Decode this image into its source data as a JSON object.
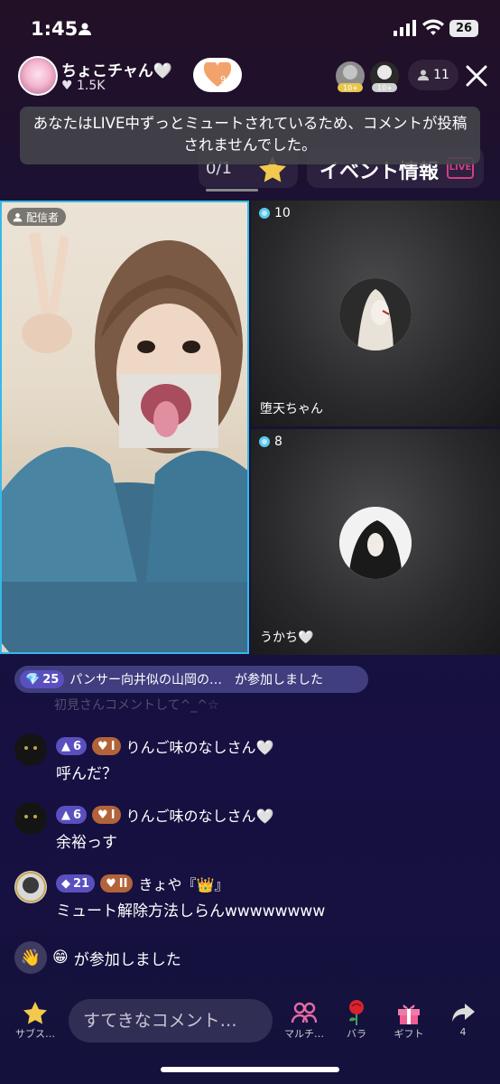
{
  "status_bar": {
    "time": "1:45",
    "battery": "26"
  },
  "host": {
    "name": "ちょこチャん🤍",
    "likes": "1.5K",
    "heart_count": "9"
  },
  "viewers": {
    "badges": [
      "10+",
      "10+"
    ],
    "count": "11"
  },
  "toast": {
    "message": "あなたはLIVE中ずっとミュートされているため、コメントが投稿されませんでした。"
  },
  "event_bar": {
    "progress": "0/1",
    "event_label": "イベント情報",
    "live_badge": "LIVE"
  },
  "grid": {
    "host_badge": "配信者",
    "guests": [
      {
        "points": "10",
        "name": "堕天ちゃん"
      },
      {
        "points": "8",
        "name": "うかち🤍"
      }
    ]
  },
  "join_banner": {
    "level": "25",
    "text": "パンサー向井似の山岡の…　が参加しました"
  },
  "faded_comment": "初見さんコメントして^_^☆",
  "comments": [
    {
      "level": "6",
      "tier": "I",
      "user": "りんご味のなしさん🤍",
      "text": "呼んだ？"
    },
    {
      "level": "6",
      "tier": "I",
      "user": "りんご味のなしさん🤍",
      "text": "余裕っす"
    },
    {
      "level": "21",
      "tier": "II",
      "user": "きょや『👑』",
      "text": "ミュート解除方法しらんwwwwwwww"
    }
  ],
  "join_line": {
    "emoji": "😁",
    "text": "が参加しました"
  },
  "bottom_bar": {
    "subscribe_label": "サブス…",
    "comment_placeholder": "すてきなコメント…",
    "multi_label": "マルチ…",
    "rose_label": "バラ",
    "gift_label": "ギフト",
    "share_count": "4"
  },
  "colors": {
    "accent_blue": "#35b8e8",
    "level_purple": "#5a4fbf",
    "level_orange": "#b2633a"
  }
}
